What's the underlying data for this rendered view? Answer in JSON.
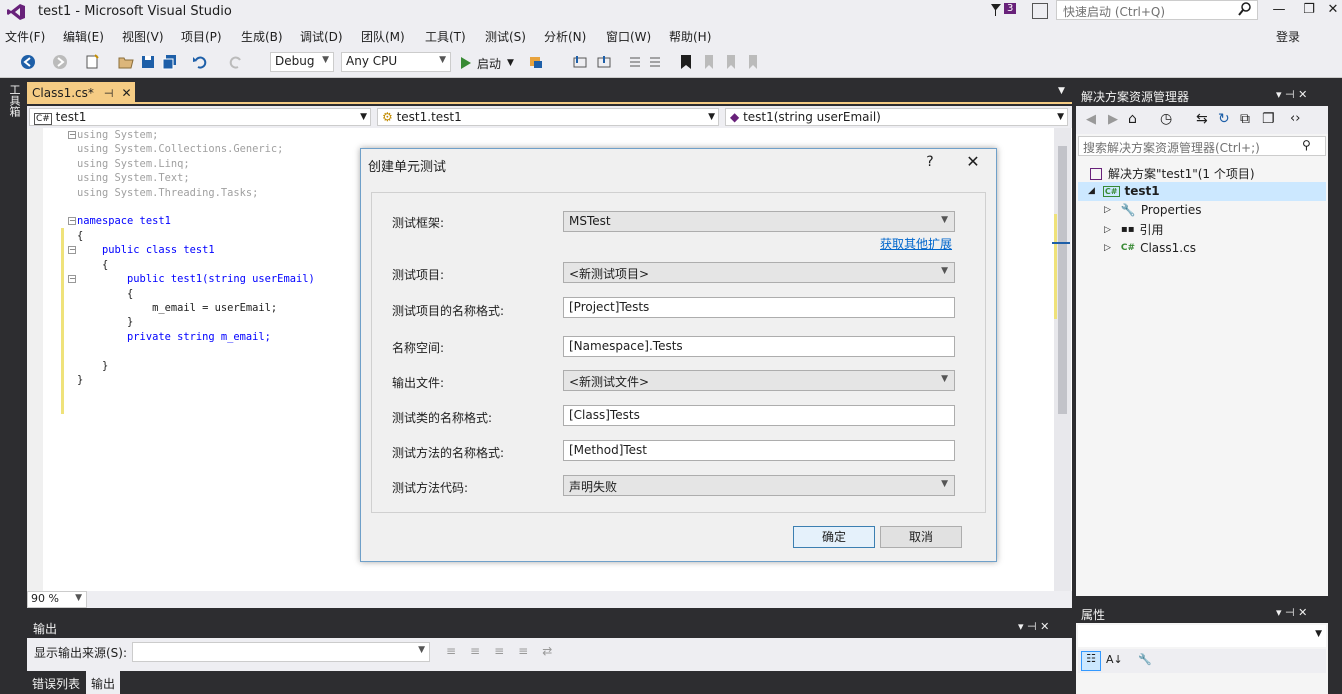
{
  "window": {
    "title": "test1 - Microsoft Visual Studio",
    "notif_count": "3",
    "quick_launch": "快速启动 (Ctrl+Q)",
    "login": "登录"
  },
  "menu": [
    "文件(F)",
    "编辑(E)",
    "视图(V)",
    "项目(P)",
    "生成(B)",
    "调试(D)",
    "团队(M)",
    "工具(T)",
    "测试(S)",
    "分析(N)",
    "窗口(W)",
    "帮助(H)"
  ],
  "toolbar": {
    "config": "Debug",
    "platform": "Any CPU",
    "start": "启动"
  },
  "left_strip": {
    "toolbox": "工具箱"
  },
  "editor": {
    "tab": "Class1.cs*",
    "nav": {
      "project": "test1",
      "type": "test1.test1",
      "member": "test1(string userEmail)"
    },
    "zoom": "90 %",
    "code": [
      "using System;",
      "using System.Collections.Generic;",
      "using System.Linq;",
      "using System.Text;",
      "using System.Threading.Tasks;",
      "",
      "namespace test1",
      "{",
      "    public class test1",
      "    {",
      "        public test1(string userEmail)",
      "        {",
      "            m_email = userEmail;",
      "        }",
      "        private string m_email;",
      "",
      "    }",
      "}"
    ]
  },
  "output": {
    "title": "输出",
    "source_label": "显示输出来源(S):",
    "tabs": [
      "错误列表",
      "输出"
    ]
  },
  "solution_explorer": {
    "title": "解决方案资源管理器",
    "search_placeholder": "搜索解决方案资源管理器(Ctrl+;)",
    "solution": "解决方案\"test1\"(1 个项目)",
    "project": "test1",
    "items": [
      "Properties",
      "引用",
      "Class1.cs"
    ]
  },
  "properties": {
    "title": "属性"
  },
  "dialog": {
    "title": "创建单元测试",
    "fields": [
      {
        "label": "测试框架:",
        "value": "MSTest",
        "type": "select"
      },
      {
        "label": "测试项目:",
        "value": "<新测试项目>",
        "type": "select"
      },
      {
        "label": "测试项目的名称格式:",
        "value": "[Project]Tests",
        "type": "text"
      },
      {
        "label": "名称空间:",
        "value": "[Namespace].Tests",
        "type": "text"
      },
      {
        "label": "输出文件:",
        "value": "<新测试文件>",
        "type": "select"
      },
      {
        "label": "测试类的名称格式:",
        "value": "[Class]Tests",
        "type": "text"
      },
      {
        "label": "测试方法的名称格式:",
        "value": "[Method]Test",
        "type": "text"
      },
      {
        "label": "测试方法代码:",
        "value": "声明失败",
        "type": "select"
      }
    ],
    "ext_link": "获取其他扩展",
    "ok": "确定",
    "cancel": "取消"
  },
  "colors": {
    "accent": "#007acc",
    "doc_tab": "#f5cc84",
    "chrome_dark": "#2d2d30",
    "chrome_light": "#eeeef2"
  }
}
